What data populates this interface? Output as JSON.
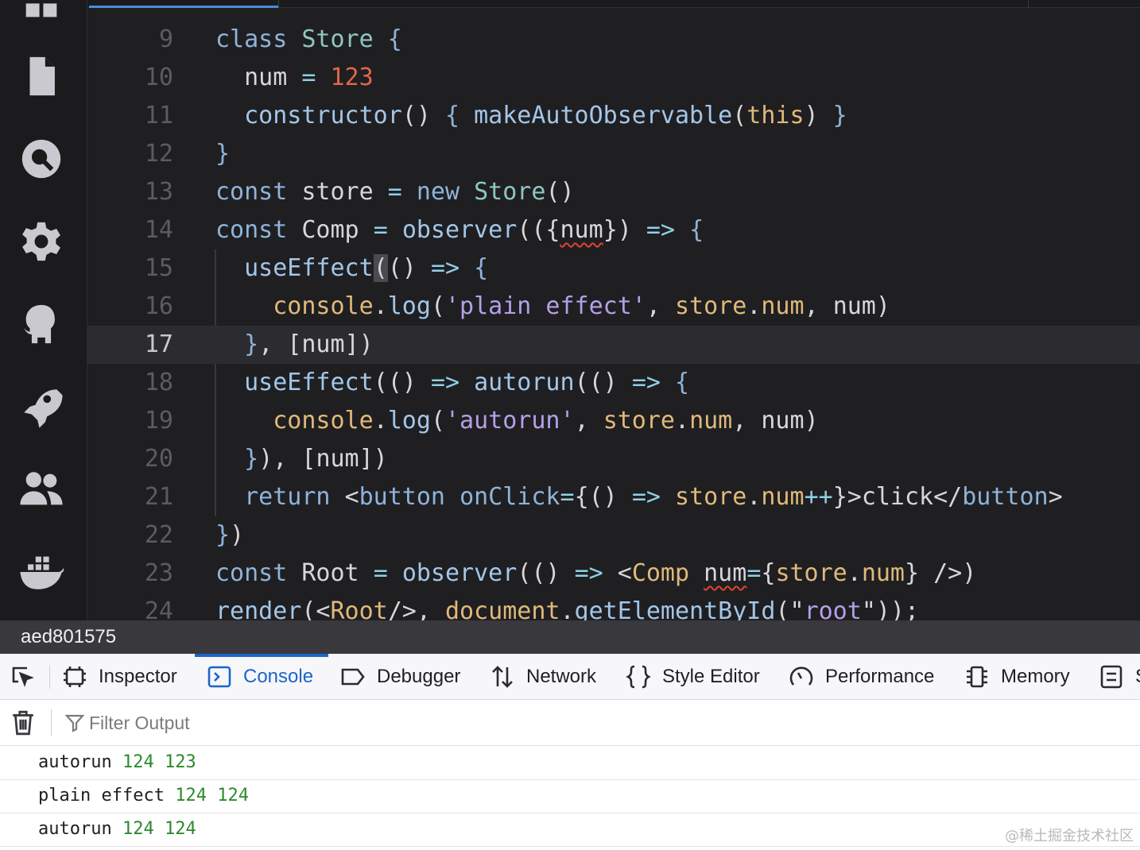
{
  "editor": {
    "lines": [
      {
        "n": "9",
        "tokens": [
          [
            "kw",
            "class "
          ],
          [
            "cls",
            "Store "
          ],
          [
            "br",
            "{"
          ]
        ]
      },
      {
        "n": "10",
        "tokens": [
          [
            "id",
            "  num "
          ],
          [
            "op",
            "= "
          ],
          [
            "num",
            "123"
          ]
        ]
      },
      {
        "n": "11",
        "tokens": [
          [
            "fn",
            "  constructor"
          ],
          [
            "pun",
            "() "
          ],
          [
            "br",
            "{ "
          ],
          [
            "fn",
            "makeAutoObservable"
          ],
          [
            "pun",
            "("
          ],
          [
            "thisk",
            "this"
          ],
          [
            "pun",
            ") "
          ],
          [
            "br",
            "}"
          ]
        ]
      },
      {
        "n": "12",
        "tokens": [
          [
            "br",
            "}"
          ]
        ]
      },
      {
        "n": "13",
        "tokens": [
          [
            "kw",
            "const "
          ],
          [
            "id",
            "store "
          ],
          [
            "op",
            "= "
          ],
          [
            "kw",
            "new "
          ],
          [
            "cls",
            "Store"
          ],
          [
            "pun",
            "()"
          ]
        ]
      },
      {
        "n": "14",
        "tokens": [
          [
            "kw",
            "const "
          ],
          [
            "id",
            "Comp "
          ],
          [
            "op",
            "= "
          ],
          [
            "fn",
            "observer"
          ],
          [
            "pun",
            "(({"
          ],
          [
            "sq",
            "num"
          ],
          [
            "pun",
            "}) "
          ],
          [
            "op",
            "=> "
          ],
          [
            "br",
            "{"
          ]
        ]
      },
      {
        "n": "15",
        "tokens": [
          [
            "fn",
            "  useEffect"
          ],
          [
            "bm",
            "("
          ],
          [
            "pun",
            "() "
          ],
          [
            "op",
            "=> "
          ],
          [
            "br",
            "{"
          ]
        ]
      },
      {
        "n": "16",
        "tokens": [
          [
            "obj",
            "    console"
          ],
          [
            "pun",
            "."
          ],
          [
            "fn",
            "log"
          ],
          [
            "pun",
            "("
          ],
          [
            "str",
            "'plain effect'"
          ],
          [
            "pun",
            ", "
          ],
          [
            "obj",
            "store"
          ],
          [
            "pun",
            "."
          ],
          [
            "prop",
            "num"
          ],
          [
            "pun",
            ", "
          ],
          [
            "id",
            "num"
          ],
          [
            "pun",
            ")"
          ]
        ]
      },
      {
        "n": "17",
        "tokens": [
          [
            "br",
            "  }"
          ],
          [
            "pun",
            ", "
          ],
          [
            "pun",
            "["
          ],
          [
            "id",
            "num"
          ],
          [
            "pun",
            "])"
          ]
        ]
      },
      {
        "n": "18",
        "tokens": [
          [
            "fn",
            "  useEffect"
          ],
          [
            "pun",
            "(() "
          ],
          [
            "op",
            "=> "
          ],
          [
            "fn",
            "autorun"
          ],
          [
            "pun",
            "(() "
          ],
          [
            "op",
            "=> "
          ],
          [
            "br",
            "{"
          ]
        ]
      },
      {
        "n": "19",
        "tokens": [
          [
            "obj",
            "    console"
          ],
          [
            "pun",
            "."
          ],
          [
            "fn",
            "log"
          ],
          [
            "pun",
            "("
          ],
          [
            "str",
            "'autorun'"
          ],
          [
            "pun",
            ", "
          ],
          [
            "obj",
            "store"
          ],
          [
            "pun",
            "."
          ],
          [
            "prop",
            "num"
          ],
          [
            "pun",
            ", "
          ],
          [
            "id",
            "num"
          ],
          [
            "pun",
            ")"
          ]
        ]
      },
      {
        "n": "20",
        "tokens": [
          [
            "br",
            "  }"
          ],
          [
            "pun",
            "), "
          ],
          [
            "pun",
            "["
          ],
          [
            "id",
            "num"
          ],
          [
            "pun",
            "])"
          ]
        ]
      },
      {
        "n": "21",
        "tokens": [
          [
            "kw",
            "  return "
          ],
          [
            "pun",
            "<"
          ],
          [
            "jsx",
            "button "
          ],
          [
            "attr",
            "onClick"
          ],
          [
            "op",
            "="
          ],
          [
            "pun",
            "{() "
          ],
          [
            "op",
            "=> "
          ],
          [
            "obj",
            "store"
          ],
          [
            "pun",
            "."
          ],
          [
            "prop",
            "num"
          ],
          [
            "op",
            "++"
          ],
          [
            "pun",
            "}>"
          ],
          [
            "id",
            "click"
          ],
          [
            "pun",
            "</"
          ],
          [
            "jsx",
            "button"
          ],
          [
            "pun",
            ">"
          ]
        ]
      },
      {
        "n": "22",
        "tokens": [
          [
            "br",
            "}"
          ],
          [
            "pun",
            ")"
          ]
        ]
      },
      {
        "n": "23",
        "tokens": [
          [
            "kw",
            "const "
          ],
          [
            "id",
            "Root "
          ],
          [
            "op",
            "= "
          ],
          [
            "fn",
            "observer"
          ],
          [
            "pun",
            "(() "
          ],
          [
            "op",
            "=> "
          ],
          [
            "pun",
            "<"
          ],
          [
            "obj",
            "Comp "
          ],
          [
            "sq",
            "num"
          ],
          [
            "op",
            "="
          ],
          [
            "pun",
            "{"
          ],
          [
            "obj",
            "store"
          ],
          [
            "pun",
            "."
          ],
          [
            "prop",
            "num"
          ],
          [
            "pun",
            "} />)"
          ]
        ]
      },
      {
        "n": "24",
        "tokens": [
          [
            "fn",
            "render"
          ],
          [
            "pun",
            "(<"
          ],
          [
            "obj",
            "Root"
          ],
          [
            "pun",
            "/>, "
          ],
          [
            "obj",
            "document"
          ],
          [
            "pun",
            "."
          ],
          [
            "fn",
            "getElementById"
          ],
          [
            "pun",
            "(\""
          ],
          [
            "str",
            "root"
          ],
          [
            "pun",
            "\"));"
          ]
        ]
      }
    ],
    "current_line": "17"
  },
  "activity_bar": {
    "icons": [
      "files-icon",
      "search-icon",
      "settings-gear-icon",
      "github-icon",
      "rocket-icon",
      "users-icon",
      "docker-icon"
    ]
  },
  "status_bar": {
    "commit": "aed801575"
  },
  "devtools": {
    "tabs": [
      {
        "id": "inspector",
        "label": "Inspector"
      },
      {
        "id": "console",
        "label": "Console",
        "active": true
      },
      {
        "id": "debugger",
        "label": "Debugger"
      },
      {
        "id": "network",
        "label": "Network"
      },
      {
        "id": "style-editor",
        "label": "Style Editor"
      },
      {
        "id": "performance",
        "label": "Performance"
      },
      {
        "id": "memory",
        "label": "Memory"
      },
      {
        "id": "storage",
        "label": "S"
      }
    ],
    "filter": {
      "placeholder": "Filter Output",
      "value": ""
    },
    "console_rows": [
      {
        "text": "autorun",
        "values": [
          "124",
          "123"
        ]
      },
      {
        "text": "plain effect",
        "values": [
          "124",
          "124"
        ]
      },
      {
        "text": "autorun",
        "values": [
          "124",
          "124"
        ]
      }
    ],
    "accent_color": "#1b65c9"
  },
  "watermark": "@稀土掘金技术社区"
}
